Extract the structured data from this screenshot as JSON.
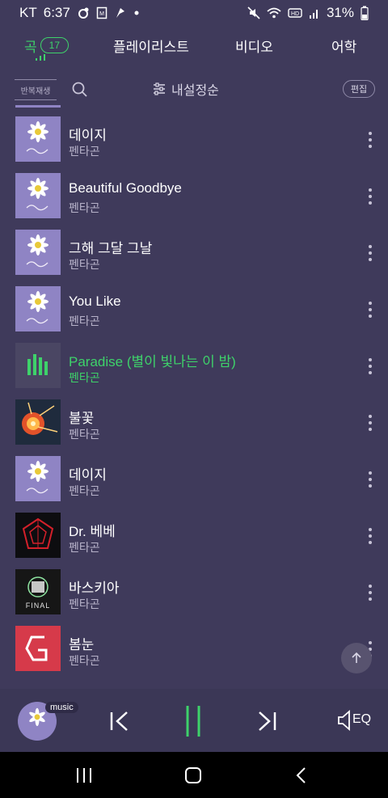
{
  "status_bar": {
    "carrier": "KT",
    "time": "6:37",
    "left_icons": [
      "dot-circle-icon",
      "badge-icon",
      "fan-icon",
      "dot-icon"
    ],
    "right_icons": [
      "mute-icon",
      "wifi-icon",
      "hd-icon",
      "signal-icon"
    ],
    "battery": "31%"
  },
  "tabs": [
    {
      "label": "곡",
      "count": "17",
      "active": true
    },
    {
      "label": "플레이리스트",
      "active": false
    },
    {
      "label": "비디오",
      "active": false
    },
    {
      "label": "어학",
      "active": false
    }
  ],
  "toolbar": {
    "repeat_label": "반복재생",
    "sort_label": "내설정순",
    "edit_label": "편집"
  },
  "songs": [
    {
      "title": "데이지",
      "artist": "펜타곤",
      "art": "daisy",
      "playing": false
    },
    {
      "title": "Beautiful Goodbye",
      "artist": "펜타곤",
      "art": "daisy",
      "playing": false
    },
    {
      "title": "그해 그달 그날",
      "artist": "펜타곤",
      "art": "daisy",
      "playing": false
    },
    {
      "title": "You Like",
      "artist": "펜타곤",
      "art": "daisy",
      "playing": false
    },
    {
      "title": "Paradise (별이 빛나는 이 밤)",
      "artist": "펜타곤",
      "art": "daisy",
      "playing": true
    },
    {
      "title": "불꽃",
      "artist": "펜타곤",
      "art": "fireworks",
      "playing": false
    },
    {
      "title": "데이지",
      "artist": "펜타곤",
      "art": "daisy",
      "playing": false
    },
    {
      "title": "Dr. 베베",
      "artist": "펜타곤",
      "art": "red-logo",
      "playing": false
    },
    {
      "title": "바스키아",
      "artist": "펜타곤",
      "art": "final",
      "playing": false
    },
    {
      "title": "봄눈",
      "artist": "펜타곤",
      "art": "red-g",
      "playing": false
    }
  ],
  "art_text": {
    "final": "FINAL"
  },
  "player": {
    "badge": "music",
    "eq_label": "EQ"
  },
  "colors": {
    "accent": "#3ed26a",
    "background": "#3f3a5b",
    "daisy_bg": "#8f84c4"
  }
}
